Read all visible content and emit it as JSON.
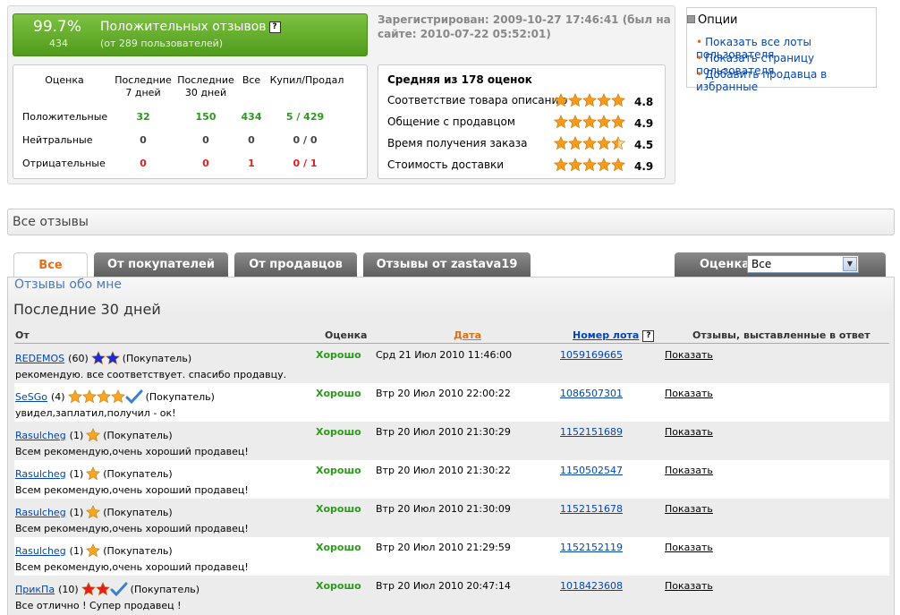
{
  "summary": {
    "percent": "99.7%",
    "count": "434",
    "title": "Положительных отзывов",
    "help": "?",
    "subtitle": "(от 289 пользователей)",
    "registered": "Зарегистрирован: 2009-10-27 17:46:41 (был на сайте: 2010-07-22 05:52:01)"
  },
  "stats": {
    "headers": [
      "Оценка",
      "Последние 7 дней",
      "Последние 30 дней",
      "Все",
      "Купил/Продал"
    ],
    "rows": [
      {
        "label": "Положительные",
        "d7": "32",
        "d30": "150",
        "all": "434",
        "bs": "5 / 429"
      },
      {
        "label": "Нейтральные",
        "d7": "0",
        "d30": "0",
        "all": "0",
        "bs": "0 / 0"
      },
      {
        "label": "Отрицательные",
        "d7": "0",
        "d30": "0",
        "all": "1",
        "bs": "0 / 1"
      }
    ]
  },
  "ratings": {
    "title": "Средняя из 178 оценок",
    "rows": [
      {
        "label": "Соответствие товара описанию",
        "value": "4.8"
      },
      {
        "label": "Общение с продавцом",
        "value": "4.9"
      },
      {
        "label": "Время получения заказа",
        "value": "4.5"
      },
      {
        "label": "Стоимость доставки",
        "value": "4.9"
      }
    ]
  },
  "options": {
    "title": "Опции",
    "items": [
      "Показать все лоты пользователя",
      "Показать страницу пользователя",
      "Добавить продавца в избранные"
    ]
  },
  "all_reviews": "Все отзывы",
  "tabs": [
    "Все",
    "От покупателей",
    "От продавцов",
    "Отзывы от zastava19"
  ],
  "grade_filter": {
    "label": "Оценка",
    "selected": "Все"
  },
  "main": {
    "about_me": "Отзывы обо мне",
    "period": "Последние 30 дней",
    "columns": [
      "От",
      "Оценка",
      "Дата",
      "Номер лота",
      "Отзывы, выставленные в ответ"
    ]
  },
  "reviews": [
    {
      "user": "REDEMOS",
      "score": "(60)",
      "role": "(Покупатель)",
      "comment": "рекомендую. все соответствует. спасибо продавцу.",
      "grade": "Хорошо",
      "date": "Срд 21 Июл 2010 11:46:00",
      "lot": "1059169665",
      "reply": "Показать"
    },
    {
      "user": "SeSGo",
      "score": "(4)",
      "role": "(Покупатель)",
      "comment": "увидел,заплатил,получил - ок!",
      "grade": "Хорошо",
      "date": "Втр 20 Июл 2010 22:00:22",
      "lot": "1086507301",
      "reply": "Показать"
    },
    {
      "user": "Rasulcheg",
      "score": "(1)",
      "role": "(Покупатель)",
      "comment": "Всем рекомендую,очень хороший продавец!",
      "grade": "Хорошо",
      "date": "Втр 20 Июл 2010 21:30:29",
      "lot": "1152151689",
      "reply": "Показать"
    },
    {
      "user": "Rasulcheg",
      "score": "(1)",
      "role": "(Покупатель)",
      "comment": "Всем рекомендую,очень хороший продавец!",
      "grade": "Хорошо",
      "date": "Втр 20 Июл 2010 21:30:22",
      "lot": "1150502547",
      "reply": "Показать"
    },
    {
      "user": "Rasulcheg",
      "score": "(1)",
      "role": "(Покупатель)",
      "comment": "Всем рекомендую,очень хороший продавец!",
      "grade": "Хорошо",
      "date": "Втр 20 Июл 2010 21:30:09",
      "lot": "1152151678",
      "reply": "Показать"
    },
    {
      "user": "Rasulcheg",
      "score": "(1)",
      "role": "(Покупатель)",
      "comment": "Всем рекомендую,очень хороший продавец!",
      "grade": "Хорошо",
      "date": "Втр 20 Июл 2010 21:29:59",
      "lot": "1152152119",
      "reply": "Показать"
    },
    {
      "user": "ПрикПа",
      "score": "(10)",
      "role": "(Покупатель)",
      "comment": "Все отлично ! Супер продавец !",
      "grade": "Хорошо",
      "date": "Втр 20 Июл 2010 20:47:14",
      "lot": "1018423608",
      "reply": "Показать"
    }
  ],
  "colors": {
    "accent_orange": "#e0701a",
    "positive_green": "#2a9a1c",
    "negative_red": "#e02020",
    "link_blue": "#0645ad",
    "star_orange": "#f5a623"
  }
}
